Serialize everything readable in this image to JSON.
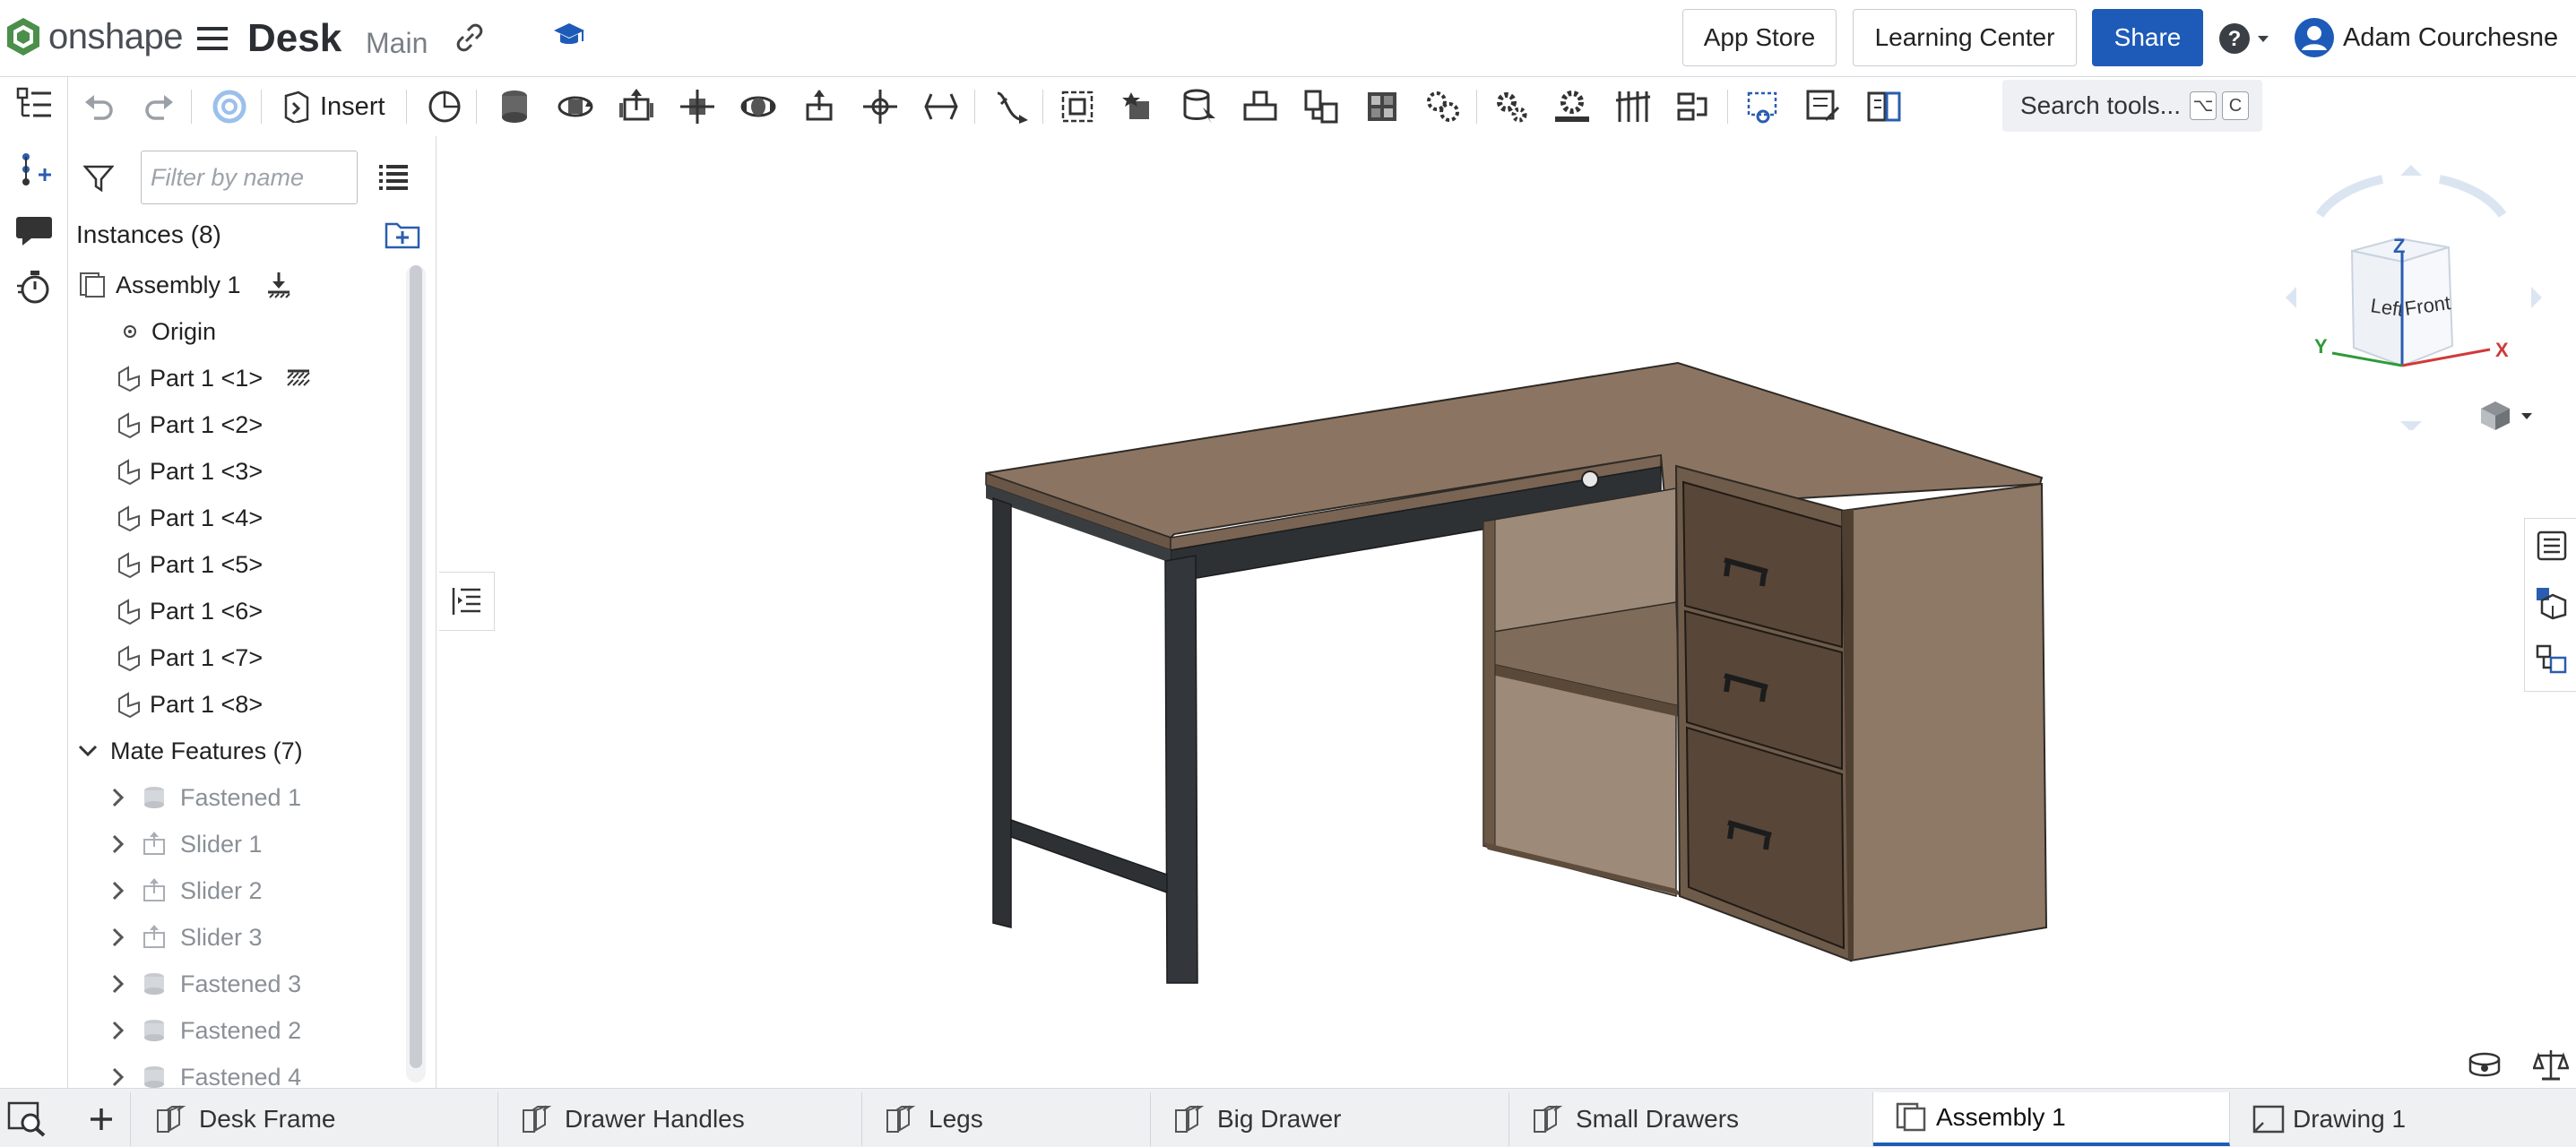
{
  "header": {
    "brand": "onshape",
    "doc_title": "Desk",
    "branch": "Main",
    "app_store": "App Store",
    "learning_center": "Learning Center",
    "share": "Share",
    "user_name": "Adam Courchesne"
  },
  "toolbar": {
    "insert_label": "Insert",
    "search_label": "Search tools...",
    "shortcut_keys": [
      "⌥",
      "C"
    ]
  },
  "panel": {
    "filter_placeholder": "Filter by name",
    "instances_header": "Instances (8)",
    "assembly_label": "Assembly 1",
    "origin_label": "Origin",
    "parts": [
      "Part 1 <1>",
      "Part 1 <2>",
      "Part 1 <3>",
      "Part 1 <4>",
      "Part 1 <5>",
      "Part 1 <6>",
      "Part 1 <7>",
      "Part 1 <8>"
    ],
    "mate_header": "Mate Features (7)",
    "mates": [
      "Fastened 1",
      "Slider 1",
      "Slider 2",
      "Slider 3",
      "Fastened 3",
      "Fastened 2",
      "Fastened 4"
    ]
  },
  "viewcube": {
    "left": "Left",
    "front": "Front",
    "x": "X",
    "y": "Y",
    "z": "Z"
  },
  "tabs": [
    "Desk Frame",
    "Drawer Handles",
    "Legs",
    "Big Drawer",
    "Small Drawers",
    "Assembly 1",
    "Drawing 1"
  ],
  "active_tab": "Assembly 1",
  "colors": {
    "accent": "#1e5bb8",
    "wood_top": "#8b7562",
    "wood_front": "#6e5a48",
    "frame": "#2e3134"
  }
}
